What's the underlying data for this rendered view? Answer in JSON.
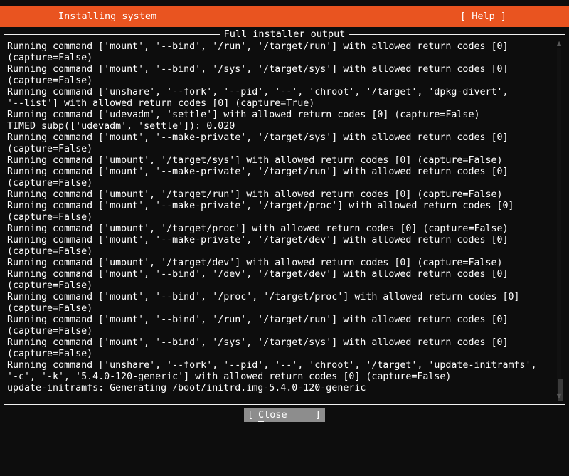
{
  "colors": {
    "accent": "#e95420",
    "background": "#0d0d0d",
    "foreground": "#ffffff",
    "button_bg": "#8d8d8d",
    "scrollbar_thumb": "#3a3a3a"
  },
  "header": {
    "title": "Installing system",
    "help_label": "[ Help ]"
  },
  "output_box": {
    "title": "Full installer output",
    "lines": [
      "Running command ['mount', '--bind', '/run', '/target/run'] with allowed return codes [0]",
      "(capture=False)",
      "Running command ['mount', '--bind', '/sys', '/target/sys'] with allowed return codes [0]",
      "(capture=False)",
      "Running command ['unshare', '--fork', '--pid', '--', 'chroot', '/target', 'dpkg-divert',",
      "'--list'] with allowed return codes [0] (capture=True)",
      "Running command ['udevadm', 'settle'] with allowed return codes [0] (capture=False)",
      "TIMED subp(['udevadm', 'settle']): 0.020",
      "Running command ['mount', '--make-private', '/target/sys'] with allowed return codes [0]",
      "(capture=False)",
      "Running command ['umount', '/target/sys'] with allowed return codes [0] (capture=False)",
      "Running command ['mount', '--make-private', '/target/run'] with allowed return codes [0]",
      "(capture=False)",
      "Running command ['umount', '/target/run'] with allowed return codes [0] (capture=False)",
      "Running command ['mount', '--make-private', '/target/proc'] with allowed return codes [0]",
      "(capture=False)",
      "Running command ['umount', '/target/proc'] with allowed return codes [0] (capture=False)",
      "Running command ['mount', '--make-private', '/target/dev'] with allowed return codes [0]",
      "(capture=False)",
      "Running command ['umount', '/target/dev'] with allowed return codes [0] (capture=False)",
      "Running command ['mount', '--bind', '/dev', '/target/dev'] with allowed return codes [0]",
      "(capture=False)",
      "Running command ['mount', '--bind', '/proc', '/target/proc'] with allowed return codes [0]",
      "(capture=False)",
      "Running command ['mount', '--bind', '/run', '/target/run'] with allowed return codes [0]",
      "(capture=False)",
      "Running command ['mount', '--bind', '/sys', '/target/sys'] with allowed return codes [0]",
      "(capture=False)",
      "Running command ['unshare', '--fork', '--pid', '--', 'chroot', '/target', 'update-initramfs',",
      "'-c', '-k', '5.4.0-120-generic'] with allowed return codes [0] (capture=False)",
      "update-initramfs: Generating /boot/initrd.img-5.4.0-120-generic"
    ]
  },
  "scrollbar": {
    "up_arrow": "▲",
    "down_arrow": "▼"
  },
  "footer": {
    "close_bracket_left": "[",
    "close_label_first": "C",
    "close_label_rest": "lose",
    "close_bracket_right": "]"
  }
}
